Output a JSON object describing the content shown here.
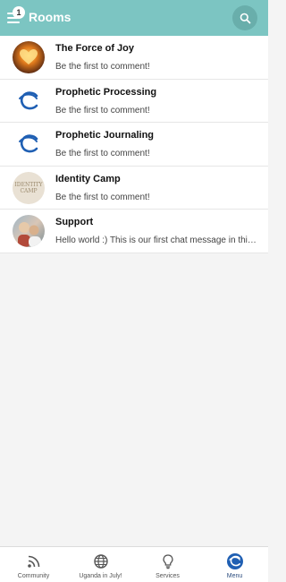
{
  "header": {
    "title": "Rooms",
    "notification_count": "1"
  },
  "rooms": [
    {
      "name": "The Force of Joy",
      "preview": "Be the first to comment!",
      "avatar": "heart-fire-image"
    },
    {
      "name": "Prophetic Processing",
      "preview": "Be the first to comment!",
      "avatar": "c-logo-icon"
    },
    {
      "name": "Prophetic Journaling",
      "preview": "Be the first to comment!",
      "avatar": "c-logo-icon"
    },
    {
      "name": "Identity Camp",
      "preview": "Be the first to comment!",
      "avatar": "identity-camp-logo",
      "avatar_text": [
        "IDENTITY",
        "CAMP"
      ]
    },
    {
      "name": "Support",
      "preview": "Hello world :) This is our first chat message in this group.",
      "avatar": "support-photo"
    }
  ],
  "nav": [
    {
      "label": "Community",
      "icon": "feed-icon"
    },
    {
      "label": "Uganda in July!",
      "icon": "globe-icon"
    },
    {
      "label": "Services",
      "icon": "lightbulb-icon"
    },
    {
      "label": "Menu",
      "icon": "brand-logo-icon"
    }
  ],
  "colors": {
    "header_bg": "#7cc5c2",
    "logo_blue": "#1f5fb3",
    "active_nav": "#1f5fb3"
  }
}
